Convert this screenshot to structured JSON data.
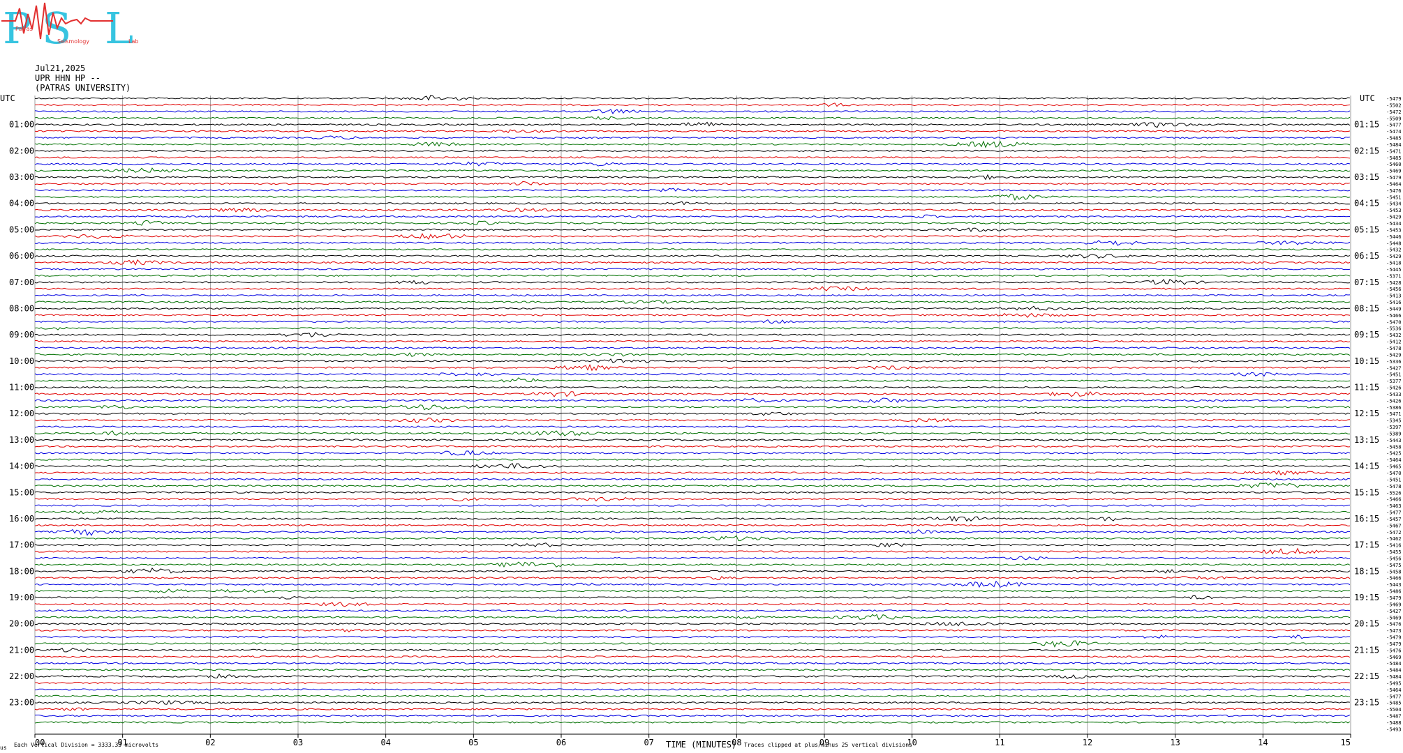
{
  "logo": {
    "letters": [
      "P",
      "S",
      "L"
    ],
    "words": [
      "Patras",
      "Seismology",
      "Lab"
    ],
    "colors": {
      "letters": "#37c4e0",
      "seismo_trace": "#e23030"
    }
  },
  "header": {
    "date": "Jul21,2025",
    "station": "UPR HHN HP --",
    "institution": "(PATRAS UNIVERSITY)"
  },
  "footer": {
    "left_caption": "Each Vertical Division = 3333.33 microvolts",
    "center_caption": "Traces clipped at plus/minus 25 vertical divisions",
    "corner_mark": "us"
  },
  "chart_data": {
    "type": "line",
    "title": "",
    "xlabel": "TIME (MINUTES)",
    "ylabel": "UTC",
    "right_label": "UTC",
    "xlim": [
      0,
      15
    ],
    "x_ticks": [
      "00",
      "01",
      "02",
      "03",
      "04",
      "05",
      "06",
      "07",
      "08",
      "09",
      "10",
      "11",
      "12",
      "13",
      "14",
      "15"
    ],
    "left_hour_labels": [
      "01:00",
      "02:00",
      "03:00",
      "04:00",
      "05:00",
      "06:00",
      "07:00",
      "08:00",
      "09:00",
      "10:00",
      "11:00",
      "12:00",
      "13:00",
      "14:00",
      "15:00",
      "16:00",
      "17:00",
      "18:00",
      "19:00",
      "20:00",
      "21:00",
      "22:00",
      "23:00"
    ],
    "right_hour_labels": [
      "01:15",
      "02:15",
      "03:15",
      "04:15",
      "05:15",
      "06:15",
      "07:15",
      "08:15",
      "09:15",
      "10:15",
      "11:15",
      "12:15",
      "13:15",
      "14:15",
      "15:15",
      "16:15",
      "17:15",
      "18:15",
      "19:15",
      "20:15",
      "21:15",
      "22:15",
      "23:15"
    ],
    "trace_colors": [
      "#000000",
      "#e00000",
      "#0000e0",
      "#007000"
    ],
    "trace_count": 96,
    "trace_minutes": 15,
    "grid": "vertical minute lines",
    "offsets": [
      -5479,
      -5502,
      -5472,
      -5509,
      -5477,
      -5474,
      -5485,
      -5484,
      -5471,
      -5485,
      -5460,
      -5469,
      -5479,
      -5464,
      -5476,
      -5451,
      -5434,
      -5453,
      -5429,
      -5434,
      -5453,
      -5446,
      -5448,
      -5432,
      -5429,
      -5418,
      -5445,
      -5371,
      -5428,
      -5456,
      -5413,
      -5416,
      -5449,
      -5466,
      -5470,
      -5536,
      -5432,
      -5412,
      -5478,
      -5429,
      -5336,
      -5427,
      -5451,
      -5377,
      -5426,
      -5433,
      -5426,
      -5386,
      -5471,
      -5345,
      -5397,
      -5389,
      -5443,
      -5458,
      -5425,
      -5464,
      -5465,
      -5470,
      -5451,
      -5478,
      -5526,
      -5466,
      -5463,
      -5477,
      -5457,
      -5467,
      -5472,
      -5462,
      -5416,
      -5455,
      -5456,
      -5475,
      -5458,
      -5466,
      -5443,
      -5486,
      -5479,
      -5469,
      -5427,
      -5469,
      -5476,
      -5473,
      -5479,
      -5479,
      -5476,
      -5469,
      -5484,
      -5484,
      -5484,
      -5495,
      -5464,
      -5477,
      -5485,
      -5504,
      -5487,
      -5488,
      -5493
    ]
  }
}
